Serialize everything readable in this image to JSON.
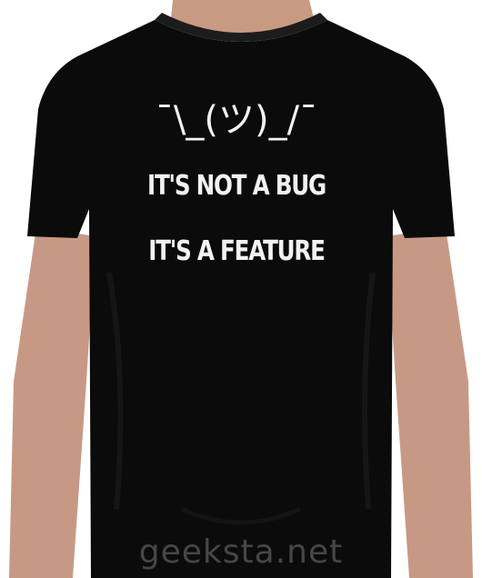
{
  "print": {
    "emoticon": "¯\\_(ツ)_/¯",
    "line1": "IT'S NOT A BUG",
    "line2": "IT'S A FEATURE"
  },
  "watermark": "geeksta.net",
  "colors": {
    "shirt": "#0b0b0b",
    "print": "#f2f2f2",
    "skin": "#c89a82",
    "background": "#ffffff"
  }
}
